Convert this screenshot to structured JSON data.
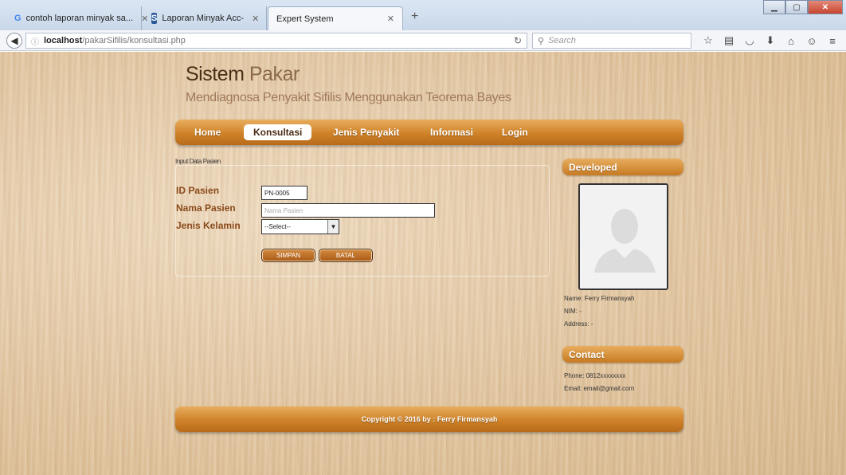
{
  "browser": {
    "tabs": [
      {
        "title": "contoh laporan minyak sa...",
        "icon": "google-icon"
      },
      {
        "title": "Laporan Minyak Acc-",
        "icon": "site-s-icon"
      },
      {
        "title": "Expert System",
        "icon": "none"
      }
    ],
    "url_host": "localhost",
    "url_path": "/pakarSifilis/konsultasi.php",
    "search_placeholder": "Search"
  },
  "site": {
    "title_part1": "Sistem",
    "title_part2": "Pakar",
    "subtitle": "Mendiagnosa Penyakit Sifilis Menggunakan Teorema Bayes"
  },
  "menu": {
    "items": [
      "Home",
      "Konsultasi",
      "Jenis Penyakit",
      "Informasi",
      "Login"
    ],
    "active": "Konsultasi"
  },
  "form": {
    "caption": "Input Data Pasien",
    "id_label": "ID Pasien",
    "id_value": "PN-0005",
    "name_label": "Nama Pasien",
    "name_placeholder": "Nama Pasien",
    "gender_label": "Jenis Kelamin",
    "gender_selected": "--Select--",
    "save_button": "SIMPAN",
    "cancel_button": "BATAL"
  },
  "sidebar": {
    "developed_title": "Developed",
    "name": "Name: Ferry Firmansyah",
    "nim": "NIM: -",
    "address": "Address: -",
    "contact_title": "Contact",
    "phone": "Phone: 0812xxxxxxxx",
    "email": "Email: email@gmail.com"
  },
  "footer": {
    "copyright": "Copyright © 2016 by : Ferry Firmansyah"
  },
  "colors": {
    "menu_orange": "#cf8228",
    "label_brown": "#8a4a1a",
    "page_wood": "#e2c7a2"
  }
}
